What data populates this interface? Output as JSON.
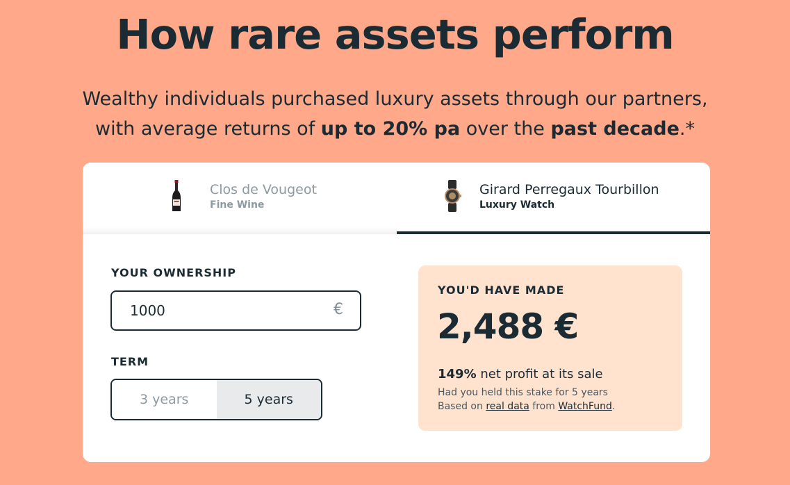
{
  "headline": "How rare assets perform",
  "subtitle": {
    "line1": "Wealthy individuals purchased luxury assets through our partners,",
    "line2_prefix": "with average returns of ",
    "line2_bold1": "up to 20% pa",
    "line2_middle": " over the ",
    "line2_bold2": "past decade",
    "line2_suffix": ".*"
  },
  "tabs": [
    {
      "title": "Clos de Vougeot",
      "subtitle": "Fine Wine",
      "icon": "wine-bottle-icon",
      "active": false
    },
    {
      "title": "Girard Perregaux Tourbillon",
      "subtitle": "Luxury Watch",
      "icon": "watch-icon",
      "active": true
    }
  ],
  "form": {
    "ownership_label": "YOUR OWNERSHIP",
    "amount": "1000",
    "currency": "€",
    "term_label": "TERM",
    "term_options": [
      {
        "label": "3 years",
        "selected": false
      },
      {
        "label": "5 years",
        "selected": true
      }
    ]
  },
  "result": {
    "label": "YOU'D HAVE MADE",
    "value": "2,488 €",
    "profit_pct": "149%",
    "profit_text": " net profit at its sale",
    "note1": "Had you held this stake for 5 years",
    "note2_prefix": "Based on ",
    "note2_link1": "real data",
    "note2_middle": " from ",
    "note2_link2": "WatchFund",
    "note2_suffix": "."
  },
  "colors": {
    "background": "#ffa88a",
    "dark": "#1b2b33",
    "result_bg": "#ffe3cf",
    "muted": "#8d9aa1"
  }
}
